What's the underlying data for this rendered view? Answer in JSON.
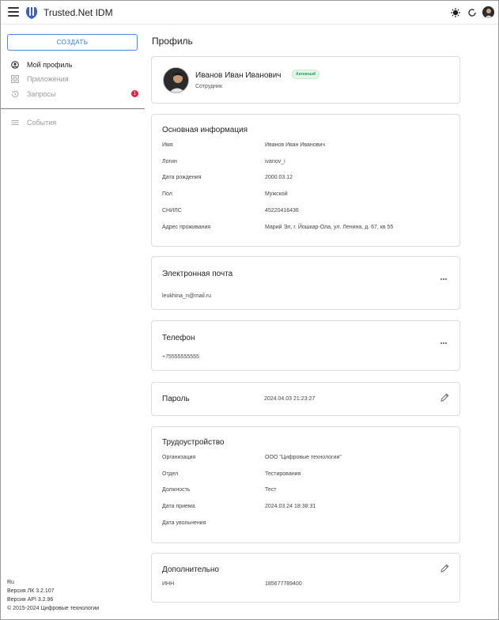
{
  "header": {
    "app_title": "Trusted.Net IDM",
    "icons": [
      "menu-icon",
      "app-logo",
      "theme-toggle-icon",
      "sync-icon",
      "user-avatar"
    ]
  },
  "sidebar": {
    "create_label": "СОЗДАТЬ",
    "items": [
      {
        "label": "Мой профиль",
        "icon": "user-circle-icon",
        "active": true
      },
      {
        "label": "Приложения",
        "icon": "apps-grid-icon",
        "active": false
      },
      {
        "label": "Запросы",
        "icon": "history-icon",
        "active": false,
        "badge": "1"
      },
      {
        "label": "События",
        "icon": "list-icon",
        "active": false
      }
    ],
    "footer": {
      "lang": "Ru",
      "version_lk": "Версия ЛК 3.2.107",
      "version_api": "Версия API 3.2.96",
      "copyright": "© 2015-2024 Цифровые технологии"
    }
  },
  "main": {
    "page_title": "Профиль",
    "profile": {
      "name": "Иванов Иван Иванович",
      "status": "Активный",
      "role": "Сотрудник"
    },
    "basic_info": {
      "title": "Основная информация",
      "rows": [
        {
          "label": "Имя",
          "value": "Иванов Иван Иванович"
        },
        {
          "label": "Логин",
          "value": "ivanov_i"
        },
        {
          "label": "Дата рождения",
          "value": "2000.03.12"
        },
        {
          "label": "Пол",
          "value": "Мужской"
        },
        {
          "label": "СНИЛС",
          "value": "45220416436"
        },
        {
          "label": "Адрес проживания",
          "value": "Марий Эл, г. Йошкар-Ола, ул. Ленина, д. 67, кв 55"
        }
      ]
    },
    "email": {
      "title": "Электронная почта",
      "value": "leukhina_n@mail.ru"
    },
    "phone": {
      "title": "Телефон",
      "value": "+75555555555"
    },
    "password": {
      "title": "Пароль",
      "value": "2024.04.03 21:23:27"
    },
    "employment": {
      "title": "Трудоустройство",
      "rows": [
        {
          "label": "Организация",
          "value": "ООО \"Цифровые технологии\""
        },
        {
          "label": "Отдел",
          "value": "Тестирования"
        },
        {
          "label": "Должность",
          "value": "Тест"
        },
        {
          "label": "Дата приема",
          "value": "2024.03.24 18:38:31"
        },
        {
          "label": "Дата увольнения",
          "value": ""
        }
      ]
    },
    "additional": {
      "title": "Дополнительно",
      "rows": [
        {
          "label": "ИНН",
          "value": "185677789400"
        }
      ]
    }
  },
  "colors": {
    "accent": "#2f7bd3",
    "status_green": "#2ea057",
    "badge_red": "#e5243f",
    "border": "#dcdcdc"
  }
}
